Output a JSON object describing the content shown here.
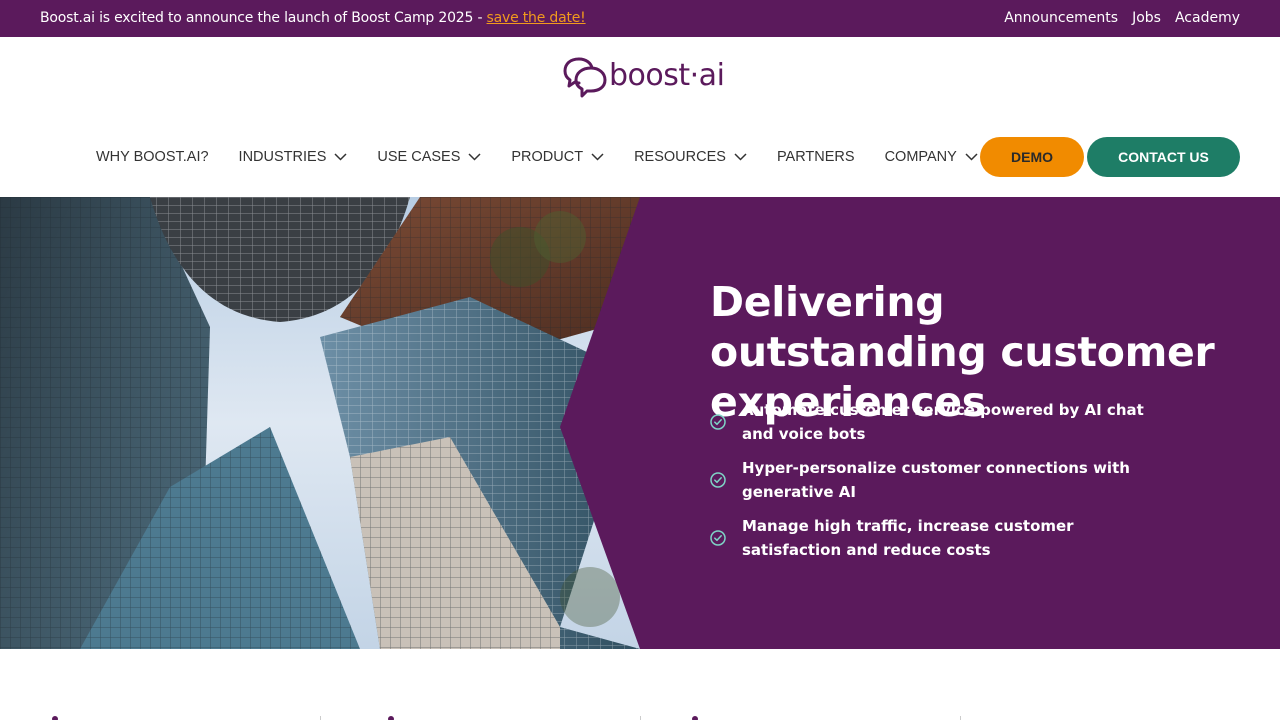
{
  "announcement": {
    "message": "Boost.ai is excited to announce the launch of Boost Camp 2025 - ",
    "link": "save the date!",
    "links": [
      "Announcements",
      "Jobs",
      "Academy"
    ]
  },
  "logo": {
    "text": "boost·ai",
    "icon": "chat-bubbles-logo"
  },
  "nav": {
    "items": [
      {
        "label": "WHY BOOST.AI?",
        "dropdown": false
      },
      {
        "label": "INDUSTRIES",
        "dropdown": true
      },
      {
        "label": "USE CASES",
        "dropdown": true
      },
      {
        "label": "PRODUCT",
        "dropdown": true
      },
      {
        "label": "RESOURCES",
        "dropdown": true
      },
      {
        "label": "PARTNERS",
        "dropdown": false
      },
      {
        "label": "COMPANY",
        "dropdown": true
      }
    ],
    "demo": "DEMO",
    "contact": "CONTACT US"
  },
  "hero": {
    "title": "Delivering outstanding customer experiences",
    "bullets": [
      "Automate customer service powered by AI chat and voice bots",
      "Hyper-personalize customer connections with generative AI",
      "Manage high traffic, increase customer satisfaction and reduce costs"
    ]
  },
  "colors": {
    "brand_purple": "#5b1a5c",
    "demo_orange": "#f18b00",
    "contact_green": "#1e7d66",
    "check_teal": "#7fd4c6"
  }
}
